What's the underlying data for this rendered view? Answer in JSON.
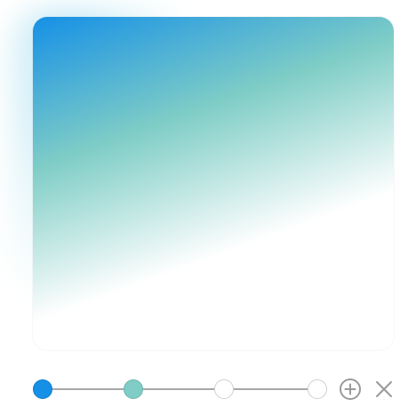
{
  "gradient": {
    "angle_deg": 160,
    "stops": [
      {
        "color": "#1590e6",
        "position": 0.0
      },
      {
        "color": "#7fcdc6",
        "position": 0.33
      },
      {
        "color": "#ffffff",
        "position": 0.66
      },
      {
        "color": "#ffffff",
        "position": 1.0
      }
    ]
  },
  "controls": {
    "add_icon": "plus-circle-icon",
    "remove_icon": "close-icon"
  },
  "colors": {
    "track": "#a8a8a8",
    "icon": "#9a9a9a",
    "stop_border": "#cfcfcf"
  }
}
